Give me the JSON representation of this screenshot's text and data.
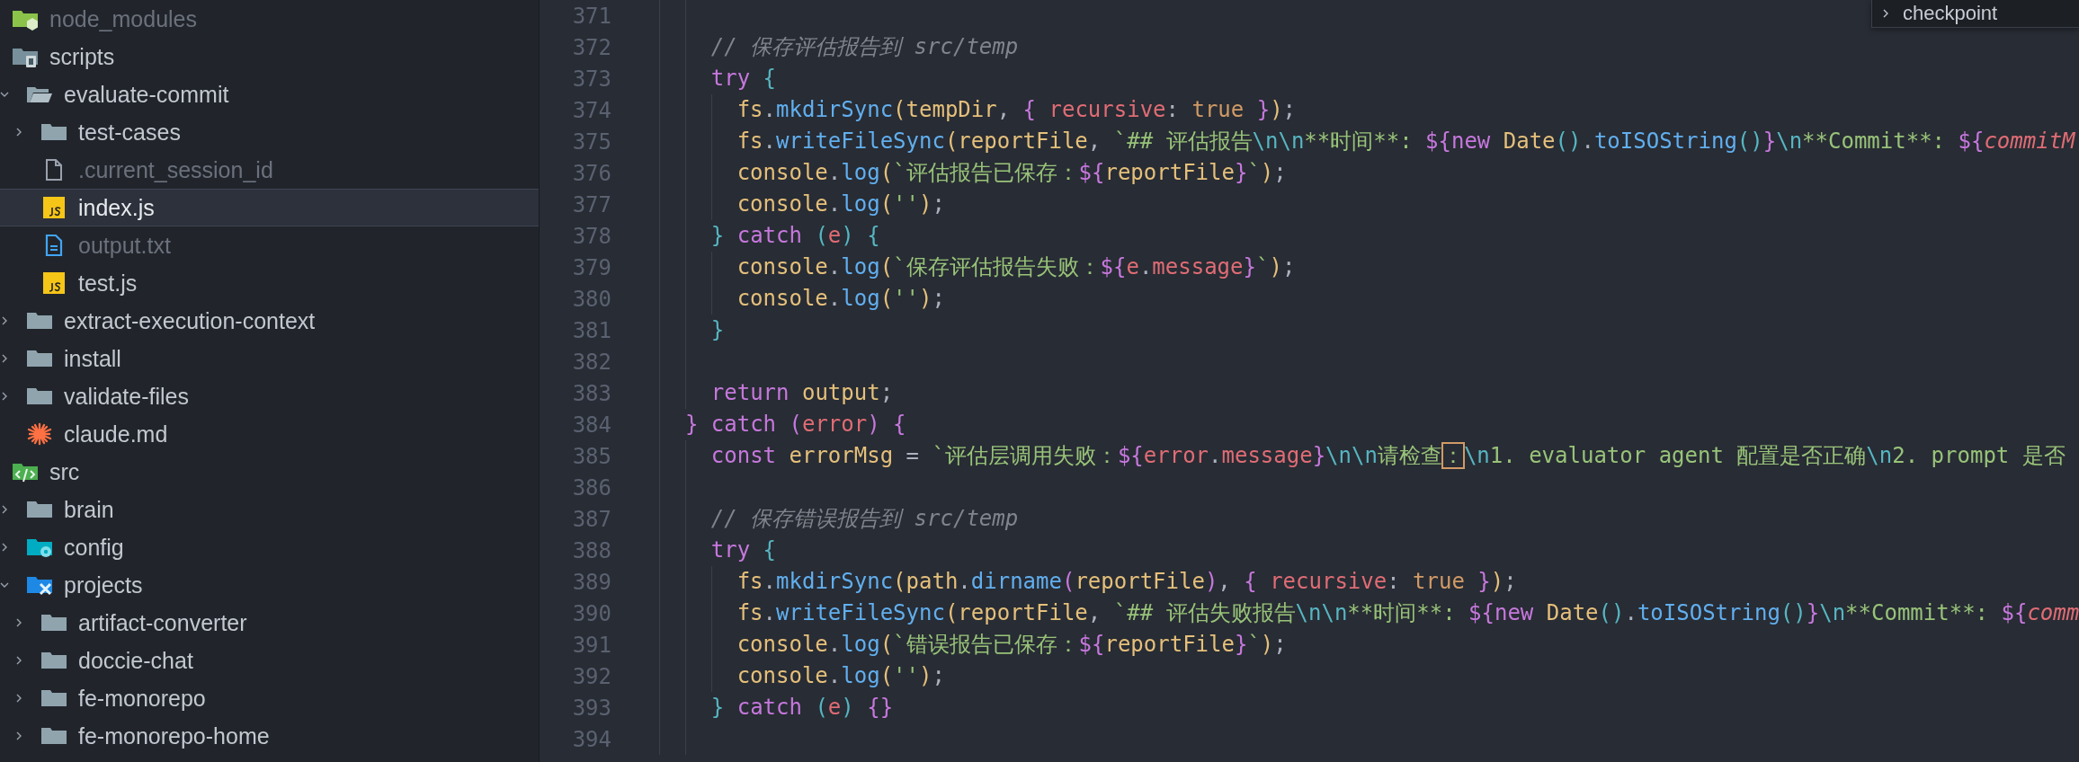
{
  "explorer": {
    "items": [
      {
        "name": "node_modules",
        "kind": "node_folder",
        "ignored": true,
        "selected": false
      },
      {
        "name": "scripts",
        "kind": "scripts_folder",
        "ignored": false,
        "selected": false,
        "children": [
          {
            "name": "evaluate-commit",
            "kind": "folder",
            "expanded": true,
            "ignored": false,
            "selected": false,
            "children": [
              {
                "name": "test-cases",
                "kind": "folder",
                "expanded": false,
                "ignored": false,
                "selected": false
              },
              {
                "name": ".current_session_id",
                "kind": "file",
                "ignored": true,
                "selected": false
              },
              {
                "name": "index.js",
                "kind": "js",
                "ignored": false,
                "selected": true
              },
              {
                "name": "output.txt",
                "kind": "txt",
                "ignored": true,
                "selected": false
              },
              {
                "name": "test.js",
                "kind": "js",
                "ignored": false,
                "selected": false
              }
            ]
          },
          {
            "name": "extract-execution-context",
            "kind": "folder",
            "expanded": false,
            "ignored": false,
            "selected": false
          },
          {
            "name": "install",
            "kind": "folder",
            "expanded": false,
            "ignored": false,
            "selected": false
          },
          {
            "name": "validate-files",
            "kind": "folder",
            "expanded": false,
            "ignored": false,
            "selected": false
          },
          {
            "name": "claude.md",
            "kind": "claude",
            "ignored": false,
            "selected": false
          }
        ]
      },
      {
        "name": "src",
        "kind": "src_folder",
        "ignored": false,
        "selected": false,
        "children": [
          {
            "name": "brain",
            "kind": "folder",
            "expanded": false,
            "ignored": false,
            "selected": false
          },
          {
            "name": "config",
            "kind": "config_folder",
            "expanded": false,
            "ignored": false,
            "selected": false
          },
          {
            "name": "projects",
            "kind": "projects_folder",
            "expanded": true,
            "ignored": false,
            "selected": false,
            "children": [
              {
                "name": "artifact-converter",
                "kind": "folder",
                "expanded": false,
                "ignored": false,
                "selected": false
              },
              {
                "name": "doccie-chat",
                "kind": "folder",
                "expanded": false,
                "ignored": false,
                "selected": false
              },
              {
                "name": "fe-monorepo",
                "kind": "folder",
                "expanded": false,
                "ignored": false,
                "selected": false
              },
              {
                "name": "fe-monorepo-home",
                "kind": "folder",
                "expanded": false,
                "ignored": false,
                "selected": false
              }
            ]
          }
        ]
      }
    ]
  },
  "editor": {
    "lines": [
      {
        "number": "371"
      },
      {
        "number": "372",
        "tokens": [
          {
            "kind": "comment",
            "text": "    // 保存评估报告到 src/temp"
          }
        ]
      },
      {
        "number": "373",
        "tokens": [
          {
            "kind": "keyword",
            "text": "    try "
          },
          {
            "kind": "brace_cyan",
            "text": "{"
          }
        ]
      },
      {
        "number": "374",
        "tokens": [
          {
            "kind": "variable",
            "text": "      fs"
          },
          {
            "kind": "punct",
            "text": "."
          },
          {
            "kind": "function",
            "text": "mkdirSync"
          },
          {
            "kind": "brace_gold",
            "text": "("
          },
          {
            "kind": "variable",
            "text": "tempDir"
          },
          {
            "kind": "punct",
            "text": ", "
          },
          {
            "kind": "brace_purple",
            "text": "{ "
          },
          {
            "kind": "property",
            "text": "recursive"
          },
          {
            "kind": "punct",
            "text": ": "
          },
          {
            "kind": "boolean",
            "text": "true "
          },
          {
            "kind": "brace_purple",
            "text": "}"
          },
          {
            "kind": "brace_gold",
            "text": ")"
          },
          {
            "kind": "punct",
            "text": ";"
          }
        ]
      },
      {
        "number": "375",
        "tokens": [
          {
            "kind": "variable",
            "text": "      fs"
          },
          {
            "kind": "punct",
            "text": "."
          },
          {
            "kind": "function",
            "text": "writeFileSync"
          },
          {
            "kind": "brace_gold",
            "text": "("
          },
          {
            "kind": "variable",
            "text": "reportFile"
          },
          {
            "kind": "punct",
            "text": ", "
          },
          {
            "kind": "string",
            "text": "`## 评估报告"
          },
          {
            "kind": "escape",
            "text": "\\n\\n"
          },
          {
            "kind": "string",
            "text": "**时间**: "
          },
          {
            "kind": "interp",
            "text": "${"
          },
          {
            "kind": "keyword",
            "text": "new "
          },
          {
            "kind": "class",
            "text": "Date"
          },
          {
            "kind": "brace_cyan",
            "text": "()"
          },
          {
            "kind": "punct",
            "text": "."
          },
          {
            "kind": "function",
            "text": "toISOString"
          },
          {
            "kind": "brace_cyan",
            "text": "()"
          },
          {
            "kind": "interp",
            "text": "}"
          },
          {
            "kind": "escape",
            "text": "\\n"
          },
          {
            "kind": "string",
            "text": "**Commit**: "
          },
          {
            "kind": "interp",
            "text": "${"
          },
          {
            "kind": "property_italic",
            "text": "commitM"
          }
        ]
      },
      {
        "number": "376",
        "tokens": [
          {
            "kind": "variable",
            "text": "      console"
          },
          {
            "kind": "punct",
            "text": "."
          },
          {
            "kind": "function",
            "text": "log"
          },
          {
            "kind": "brace_gold",
            "text": "("
          },
          {
            "kind": "string",
            "text": "`评估报告已保存："
          },
          {
            "kind": "interp",
            "text": "${"
          },
          {
            "kind": "variable",
            "text": "reportFile"
          },
          {
            "kind": "interp",
            "text": "}"
          },
          {
            "kind": "string",
            "text": "`"
          },
          {
            "kind": "brace_gold",
            "text": ")"
          },
          {
            "kind": "punct",
            "text": ";"
          }
        ]
      },
      {
        "number": "377",
        "tokens": [
          {
            "kind": "variable",
            "text": "      console"
          },
          {
            "kind": "punct",
            "text": "."
          },
          {
            "kind": "function",
            "text": "log"
          },
          {
            "kind": "brace_gold",
            "text": "("
          },
          {
            "kind": "string",
            "text": "''"
          },
          {
            "kind": "brace_gold",
            "text": ")"
          },
          {
            "kind": "punct",
            "text": ";"
          }
        ]
      },
      {
        "number": "378",
        "tokens": [
          {
            "kind": "brace_cyan",
            "text": "    } "
          },
          {
            "kind": "keyword",
            "text": "catch "
          },
          {
            "kind": "brace_cyan",
            "text": "("
          },
          {
            "kind": "property",
            "text": "e"
          },
          {
            "kind": "brace_cyan",
            "text": ") {"
          }
        ]
      },
      {
        "number": "379",
        "tokens": [
          {
            "kind": "variable",
            "text": "      console"
          },
          {
            "kind": "punct",
            "text": "."
          },
          {
            "kind": "function",
            "text": "log"
          },
          {
            "kind": "brace_gold",
            "text": "("
          },
          {
            "kind": "string",
            "text": "`保存评估报告失败："
          },
          {
            "kind": "interp",
            "text": "${"
          },
          {
            "kind": "property",
            "text": "e"
          },
          {
            "kind": "punct",
            "text": "."
          },
          {
            "kind": "property",
            "text": "message"
          },
          {
            "kind": "interp",
            "text": "}"
          },
          {
            "kind": "string",
            "text": "`"
          },
          {
            "kind": "brace_gold",
            "text": ")"
          },
          {
            "kind": "punct",
            "text": ";"
          }
        ]
      },
      {
        "number": "380",
        "tokens": [
          {
            "kind": "variable",
            "text": "      console"
          },
          {
            "kind": "punct",
            "text": "."
          },
          {
            "kind": "function",
            "text": "log"
          },
          {
            "kind": "brace_gold",
            "text": "("
          },
          {
            "kind": "string",
            "text": "''"
          },
          {
            "kind": "brace_gold",
            "text": ")"
          },
          {
            "kind": "punct",
            "text": ";"
          }
        ]
      },
      {
        "number": "381",
        "tokens": [
          {
            "kind": "brace_cyan",
            "text": "    }"
          }
        ]
      },
      {
        "number": "382"
      },
      {
        "number": "383",
        "tokens": [
          {
            "kind": "keyword",
            "text": "    return "
          },
          {
            "kind": "variable",
            "text": "output"
          },
          {
            "kind": "punct",
            "text": ";"
          }
        ]
      },
      {
        "number": "384",
        "tokens": [
          {
            "kind": "brace_purple",
            "text": "  } "
          },
          {
            "kind": "keyword",
            "text": "catch "
          },
          {
            "kind": "brace_purple",
            "text": "("
          },
          {
            "kind": "property",
            "text": "error"
          },
          {
            "kind": "brace_purple",
            "text": ") {"
          }
        ]
      },
      {
        "number": "385",
        "tokens": [
          {
            "kind": "keyword",
            "text": "    const "
          },
          {
            "kind": "variable",
            "text": "errorMsg"
          },
          {
            "kind": "punct",
            "text": " = "
          },
          {
            "kind": "string",
            "text": "`评估层调用失败："
          },
          {
            "kind": "interp",
            "text": "${"
          },
          {
            "kind": "property",
            "text": "error"
          },
          {
            "kind": "punct",
            "text": "."
          },
          {
            "kind": "property",
            "text": "message"
          },
          {
            "kind": "interp",
            "text": "}"
          },
          {
            "kind": "escape",
            "text": "\\n\\n"
          },
          {
            "kind": "string",
            "text": "请检查"
          },
          {
            "kind": "string_boxed",
            "text": "："
          },
          {
            "kind": "escape",
            "text": "\\n"
          },
          {
            "kind": "string",
            "text": "1. evaluator agent 配置是否正确"
          },
          {
            "kind": "escape",
            "text": "\\n"
          },
          {
            "kind": "string",
            "text": "2. prompt 是否"
          }
        ]
      },
      {
        "number": "386"
      },
      {
        "number": "387",
        "tokens": [
          {
            "kind": "comment",
            "text": "    // 保存错误报告到 src/temp"
          }
        ]
      },
      {
        "number": "388",
        "tokens": [
          {
            "kind": "keyword",
            "text": "    try "
          },
          {
            "kind": "brace_cyan",
            "text": "{"
          }
        ]
      },
      {
        "number": "389",
        "tokens": [
          {
            "kind": "variable",
            "text": "      fs"
          },
          {
            "kind": "punct",
            "text": "."
          },
          {
            "kind": "function",
            "text": "mkdirSync"
          },
          {
            "kind": "brace_gold",
            "text": "("
          },
          {
            "kind": "variable",
            "text": "path"
          },
          {
            "kind": "punct",
            "text": "."
          },
          {
            "kind": "function",
            "text": "dirname"
          },
          {
            "kind": "brace_purple",
            "text": "("
          },
          {
            "kind": "variable",
            "text": "reportFile"
          },
          {
            "kind": "brace_purple",
            "text": ")"
          },
          {
            "kind": "punct",
            "text": ", "
          },
          {
            "kind": "brace_purple",
            "text": "{ "
          },
          {
            "kind": "property",
            "text": "recursive"
          },
          {
            "kind": "punct",
            "text": ": "
          },
          {
            "kind": "boolean",
            "text": "true "
          },
          {
            "kind": "brace_purple",
            "text": "}"
          },
          {
            "kind": "brace_gold",
            "text": ")"
          },
          {
            "kind": "punct",
            "text": ";"
          }
        ]
      },
      {
        "number": "390",
        "tokens": [
          {
            "kind": "variable",
            "text": "      fs"
          },
          {
            "kind": "punct",
            "text": "."
          },
          {
            "kind": "function",
            "text": "writeFileSync"
          },
          {
            "kind": "brace_gold",
            "text": "("
          },
          {
            "kind": "variable",
            "text": "reportFile"
          },
          {
            "kind": "punct",
            "text": ", "
          },
          {
            "kind": "string",
            "text": "`## 评估失败报告"
          },
          {
            "kind": "escape",
            "text": "\\n\\n"
          },
          {
            "kind": "string",
            "text": "**时间**: "
          },
          {
            "kind": "interp",
            "text": "${"
          },
          {
            "kind": "keyword",
            "text": "new "
          },
          {
            "kind": "class",
            "text": "Date"
          },
          {
            "kind": "brace_cyan",
            "text": "()"
          },
          {
            "kind": "punct",
            "text": "."
          },
          {
            "kind": "function",
            "text": "toISOString"
          },
          {
            "kind": "brace_cyan",
            "text": "()"
          },
          {
            "kind": "interp",
            "text": "}"
          },
          {
            "kind": "escape",
            "text": "\\n"
          },
          {
            "kind": "string",
            "text": "**Commit**: "
          },
          {
            "kind": "interp",
            "text": "${"
          },
          {
            "kind": "property_italic",
            "text": "comm"
          }
        ]
      },
      {
        "number": "391",
        "tokens": [
          {
            "kind": "variable",
            "text": "      console"
          },
          {
            "kind": "punct",
            "text": "."
          },
          {
            "kind": "function",
            "text": "log"
          },
          {
            "kind": "brace_gold",
            "text": "("
          },
          {
            "kind": "string",
            "text": "`错误报告已保存："
          },
          {
            "kind": "interp",
            "text": "${"
          },
          {
            "kind": "variable",
            "text": "reportFile"
          },
          {
            "kind": "interp",
            "text": "}"
          },
          {
            "kind": "string",
            "text": "`"
          },
          {
            "kind": "brace_gold",
            "text": ")"
          },
          {
            "kind": "punct",
            "text": ";"
          }
        ]
      },
      {
        "number": "392",
        "tokens": [
          {
            "kind": "variable",
            "text": "      console"
          },
          {
            "kind": "punct",
            "text": "."
          },
          {
            "kind": "function",
            "text": "log"
          },
          {
            "kind": "brace_gold",
            "text": "("
          },
          {
            "kind": "string",
            "text": "''"
          },
          {
            "kind": "brace_gold",
            "text": ")"
          },
          {
            "kind": "punct",
            "text": ";"
          }
        ]
      },
      {
        "number": "393",
        "tokens": [
          {
            "kind": "brace_cyan",
            "text": "    } "
          },
          {
            "kind": "keyword",
            "text": "catch "
          },
          {
            "kind": "brace_cyan",
            "text": "("
          },
          {
            "kind": "property",
            "text": "e"
          },
          {
            "kind": "brace_cyan",
            "text": ") "
          },
          {
            "kind": "brace_purple",
            "text": "{}"
          }
        ]
      },
      {
        "number": "394"
      }
    ]
  },
  "popup": {
    "items": [
      {
        "label": "checkpoint"
      }
    ]
  }
}
